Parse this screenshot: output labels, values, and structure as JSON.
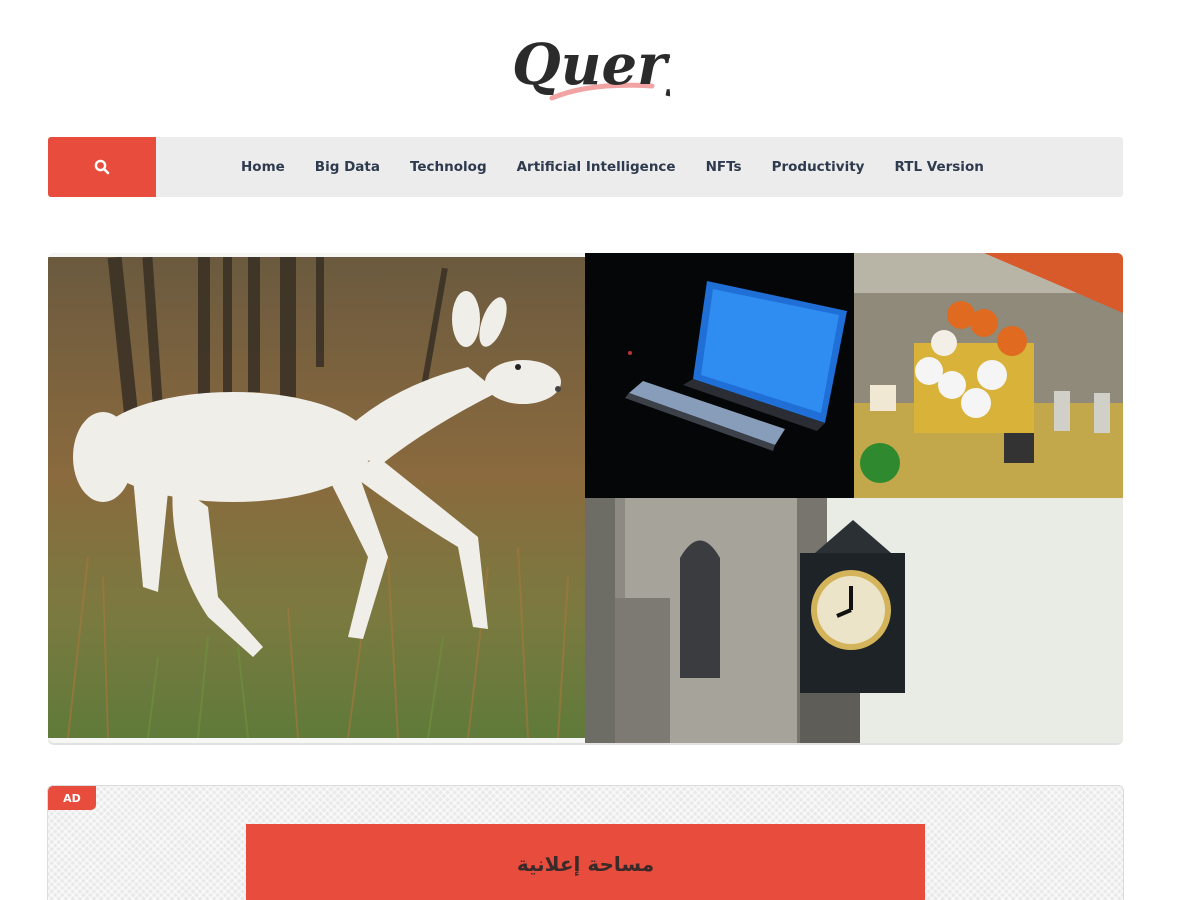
{
  "site": {
    "logo_text": "Query",
    "accent_color": "#e84c3d"
  },
  "navbar": {
    "search_icon": "search-icon",
    "items": [
      {
        "label": "Home"
      },
      {
        "label": "Big Data"
      },
      {
        "label": "Technolog"
      },
      {
        "label": "Artificial Intelligence"
      },
      {
        "label": "NFTs"
      },
      {
        "label": "Productivity"
      },
      {
        "label": "RTL Version"
      }
    ]
  },
  "hero": {
    "tiles": [
      "white-deer-photo",
      "laptop-photo",
      "lego-sports-photo",
      "clock-tower-photo"
    ]
  },
  "ad": {
    "badge": "AD",
    "space_text": "مساحة إعلانية"
  }
}
